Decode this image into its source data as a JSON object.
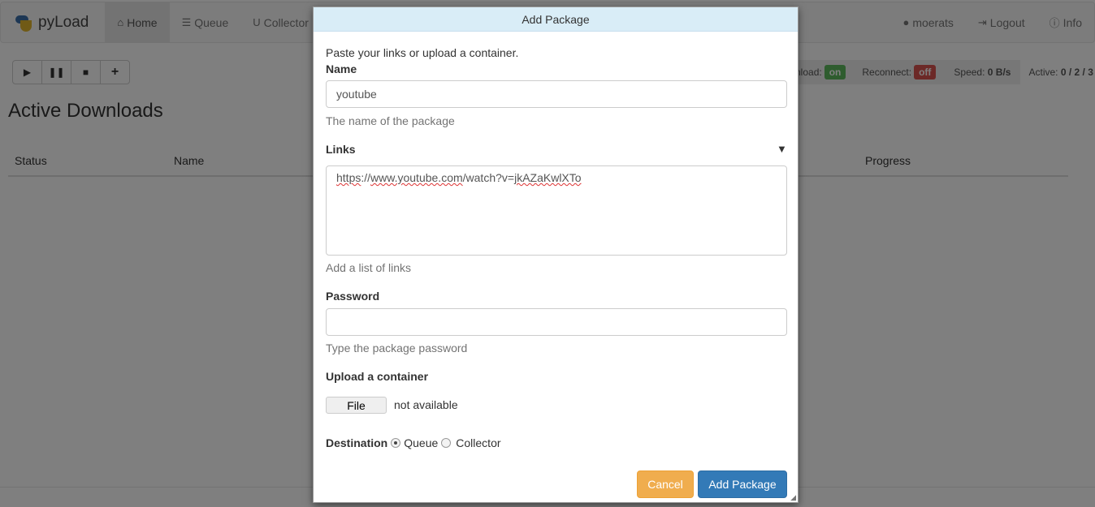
{
  "navbar": {
    "brand": "pyLoad",
    "items": [
      {
        "label": "Home",
        "icon": "home-icon",
        "active": true
      },
      {
        "label": "Queue",
        "icon": "queue-icon"
      },
      {
        "label": "Collector",
        "icon": "magnet-icon"
      }
    ],
    "right": [
      {
        "label": "moerats",
        "icon": "user-icon"
      },
      {
        "label": "Logout",
        "icon": "logout-icon"
      },
      {
        "label": "Info",
        "icon": "info-icon"
      }
    ]
  },
  "toolbar": {
    "buttons": [
      "play-icon",
      "pause-icon",
      "stop-icon",
      "plus-icon"
    ]
  },
  "status": {
    "download_label": "Download:",
    "download_value": "on",
    "reconnect_label": "Reconnect:",
    "reconnect_value": "off",
    "speed_label": "Speed:",
    "speed_value": "0 B/s",
    "active_label": "Active:",
    "active_value": "0 / 2 / 3",
    "on_color": "#5cb85c",
    "off_color": "#d9534f"
  },
  "page": {
    "title": "Active Downloads",
    "columns": [
      "Status",
      "Name",
      "Progress"
    ]
  },
  "modal": {
    "title": "Add Package",
    "intro": "Paste your links or upload a container.",
    "name_label": "Name",
    "name_value": "youtube",
    "name_help": "The name of the package",
    "links_label": "Links",
    "links_value_parts": [
      "https",
      "://",
      "www.youtube.com",
      "/watch?v=",
      "jkAZaKwlXTo"
    ],
    "links_help": "Add a list of links",
    "password_label": "Password",
    "password_value": "",
    "password_help": "Type the package password",
    "upload_label": "Upload a container",
    "file_button": "File",
    "file_status": "not available",
    "destination_label": "Destination",
    "destination_options": [
      "Queue",
      "Collector"
    ],
    "destination_selected": "Queue",
    "cancel": "Cancel",
    "submit": "Add Package"
  }
}
